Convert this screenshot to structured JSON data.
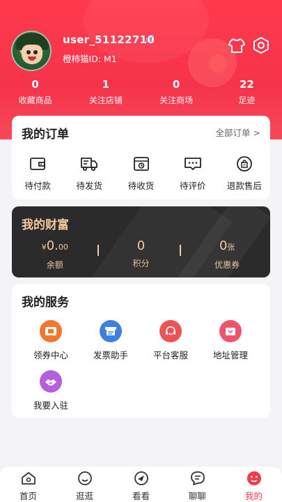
{
  "user": {
    "name": "user_51122710",
    "gender_symbol": "♂",
    "id_text": "橙柿猫ID: M1"
  },
  "stats": [
    {
      "value": "0",
      "label": "收藏商品"
    },
    {
      "value": "1",
      "label": "关注店铺"
    },
    {
      "value": "0",
      "label": "关注商场"
    },
    {
      "value": "22",
      "label": "足迹"
    }
  ],
  "orders": {
    "title": "我的订单",
    "all_label": "全部订单 >",
    "items": [
      {
        "label": "待付款",
        "icon": "wallet-icon"
      },
      {
        "label": "待发货",
        "icon": "truck-icon"
      },
      {
        "label": "待收货",
        "icon": "box-icon"
      },
      {
        "label": "待评价",
        "icon": "comment-icon"
      },
      {
        "label": "退款售后",
        "icon": "refund-bag-icon"
      }
    ]
  },
  "wealth": {
    "title": "我的财富",
    "balance": {
      "prefix": "¥",
      "main": "0.",
      "cents": "00",
      "label": "余额"
    },
    "points": {
      "value": "0",
      "label": "积分"
    },
    "coupons": {
      "value": "0",
      "unit": "张",
      "label": "优惠券"
    }
  },
  "services": {
    "title": "我的服务",
    "items": [
      {
        "label": "领券中心",
        "icon": "coupon-icon",
        "color": "#f2762e"
      },
      {
        "label": "发票助手",
        "icon": "invoice-icon",
        "color": "#3f7fe0"
      },
      {
        "label": "平台客服",
        "icon": "customer-service-icon",
        "color": "#ee5353"
      },
      {
        "label": "地址管理",
        "icon": "address-icon",
        "color": "#f0546c"
      },
      {
        "label": "我要入驻",
        "icon": "handshake-icon",
        "color": "#b45fe0"
      }
    ]
  },
  "tabbar": [
    {
      "label": "首页",
      "icon": "home-icon"
    },
    {
      "label": "逛逛",
      "icon": "smile-icon"
    },
    {
      "label": "看看",
      "icon": "eye-icon"
    },
    {
      "label": "聊聊",
      "icon": "chat-icon"
    },
    {
      "label": "我的",
      "icon": "profile-icon",
      "active": true
    }
  ],
  "colors": {
    "accent": "#f23c4c",
    "wealth_bg": "#2b2b2b",
    "wealth_text": "#f3c9a0"
  }
}
